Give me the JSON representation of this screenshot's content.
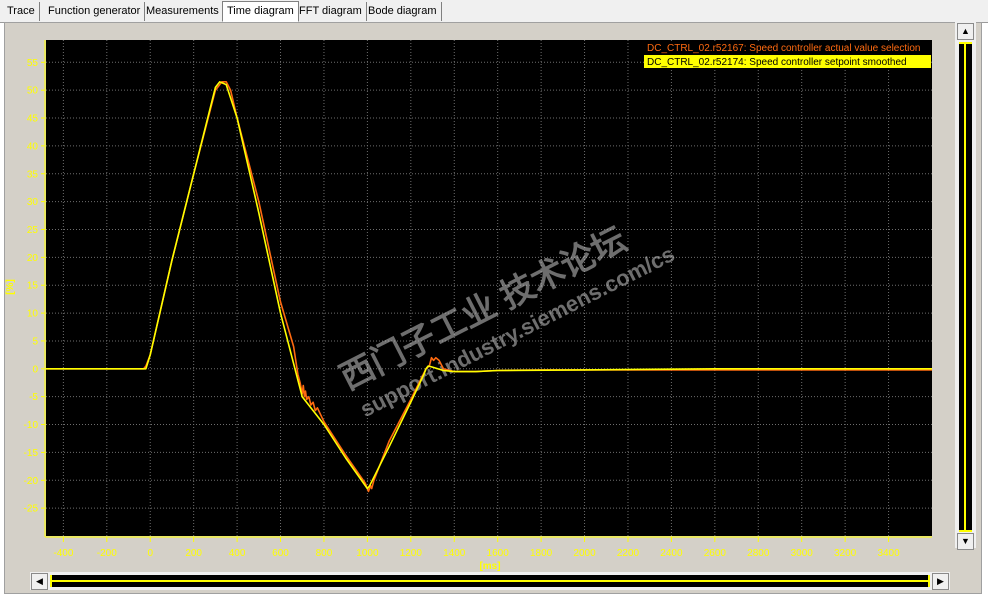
{
  "tabs": [
    {
      "label": "Trace"
    },
    {
      "label": "Function generator"
    },
    {
      "label": "Measurements"
    },
    {
      "label": "Time diagram",
      "active": true
    },
    {
      "label": "FFT diagram"
    },
    {
      "label": "Bode diagram"
    }
  ],
  "watermark": {
    "line1": "西门子工业 技术论坛",
    "line2": "support.industry.siemens.com/cs"
  },
  "colors": {
    "plot_bg": "#000000",
    "axis_and_labels": "#ffff00",
    "grid": "#6e6e6e",
    "series_actual": "#ff6a10",
    "series_setpoint": "#ffff00",
    "window_bg": "#d4d0c8"
  },
  "chart_data": {
    "type": "line",
    "xlabel": "[ms]",
    "ylabel": "[%]",
    "xlim": [
      -480,
      3600
    ],
    "ylim": [
      -30,
      59
    ],
    "x_ticks": [
      -400,
      -200,
      0,
      200,
      400,
      600,
      800,
      1000,
      1200,
      1400,
      1600,
      1800,
      2000,
      2200,
      2400,
      2600,
      2800,
      3000,
      3200,
      3400
    ],
    "y_ticks": [
      -25,
      -20,
      -15,
      -10,
      -5,
      0,
      5,
      10,
      15,
      20,
      25,
      30,
      35,
      40,
      45,
      50,
      55
    ],
    "grid": true,
    "grid_style": "dotted",
    "legend_position": "top-right",
    "series": [
      {
        "name": "DC_CTRL_02.r52167: Speed controller actual value selection",
        "color": "#ff6a10",
        "x": [
          -480,
          -30,
          -20,
          -10,
          0,
          100,
          200,
          300,
          330,
          350,
          370,
          400,
          500,
          600,
          660,
          680,
          690,
          700,
          705,
          710,
          715,
          720,
          730,
          740,
          750,
          760,
          770,
          800,
          900,
          990,
          1005,
          1015,
          1020,
          1030,
          1100,
          1200,
          1270,
          1285,
          1295,
          1305,
          1315,
          1330,
          1350,
          1400,
          1450,
          1500,
          1600,
          1800,
          2000,
          2400,
          2600,
          3000,
          3600
        ],
        "y": [
          0,
          0,
          0.5,
          1.5,
          2.5,
          19.5,
          35,
          50,
          51.5,
          51.5,
          50,
          45,
          30,
          12,
          4,
          -1,
          -2.5,
          -4.5,
          -3,
          -5,
          -4,
          -5.5,
          -5,
          -6.5,
          -6,
          -7.5,
          -7,
          -9.5,
          -15.5,
          -20.5,
          -22,
          -21,
          -21.5,
          -20,
          -13,
          -5.5,
          0,
          0.5,
          2,
          1.5,
          2,
          1.5,
          0,
          -0.5,
          -0.5,
          -0.5,
          -0.3,
          -0.2,
          -0.2,
          -0.2,
          -0.2,
          -0.2,
          -0.2
        ]
      },
      {
        "name": "DC_CTRL_02.r52174: Speed controller setpoint smoothed",
        "color": "#ffff00",
        "x": [
          -480,
          -20,
          0,
          100,
          200,
          300,
          320,
          350,
          400,
          500,
          600,
          700,
          800,
          900,
          1000,
          1010,
          1100,
          1200,
          1260,
          1270,
          1280,
          1300,
          1350,
          1400,
          1500,
          1600,
          2000,
          2600,
          3000,
          3600
        ],
        "y": [
          0,
          0,
          2.5,
          19.5,
          35,
          50.5,
          51.5,
          51,
          45,
          28,
          10,
          -5,
          -10,
          -16,
          -21.5,
          -21,
          -14,
          -6,
          -1,
          0,
          0.5,
          0.3,
          -0.3,
          -0.5,
          -0.5,
          -0.3,
          -0.2,
          0,
          0,
          0
        ]
      }
    ]
  }
}
